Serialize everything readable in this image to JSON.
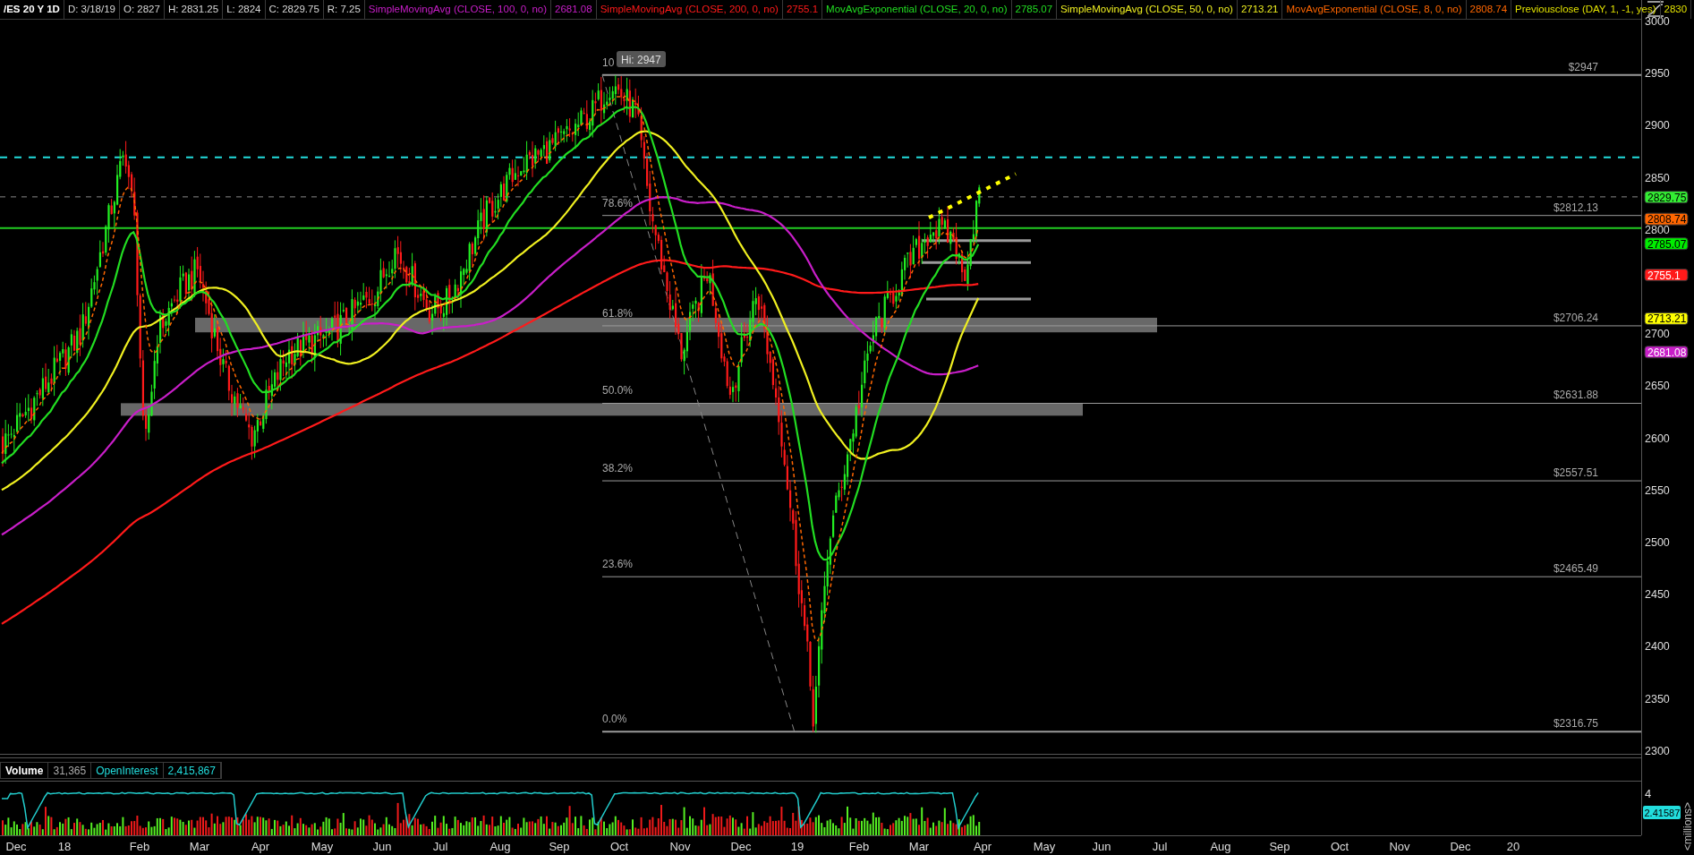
{
  "header": {
    "symbol": "/ES 20 Y 1D",
    "fields": [
      "D: 3/18/19",
      "O: 2827",
      "H: 2831.25",
      "L: 2824",
      "C: 2829.75",
      "R: 7.25"
    ],
    "studies": [
      {
        "name": "SimpleMovingAvg (CLOSE, 100, 0, no)",
        "value": "2681.08",
        "color": "#c81ec8"
      },
      {
        "name": "SimpleMovingAvg (CLOSE, 200, 0, no)",
        "value": "2755.1",
        "color": "#ff1a1a"
      },
      {
        "name": "MovAvgExponential (CLOSE, 20, 0, no)",
        "value": "2785.07",
        "color": "#22dd22"
      },
      {
        "name": "SimpleMovingAvg (CLOSE, 50, 0, no)",
        "value": "2713.21",
        "color": "#f0f020"
      },
      {
        "name": "MovAvgExponential (CLOSE, 8, 0, no)",
        "value": "2808.74",
        "color": "#ff6600"
      },
      {
        "name": "Previousclose (DAY, 1, -1, yes)",
        "value": "2830",
        "color": "#e0e000"
      }
    ]
  },
  "price_axis": [
    "3000",
    "2950",
    "2900",
    "2850",
    "2800",
    "2700",
    "2650",
    "2600",
    "2550",
    "2500",
    "2450",
    "2400",
    "2350",
    "2300"
  ],
  "price_tags": [
    {
      "value": "2829.75",
      "color": "#33ee33"
    },
    {
      "value": "2808.74",
      "color": "#ff6600"
    },
    {
      "value": "2785.07",
      "color": "#00ee00"
    },
    {
      "value": "2755.1",
      "color": "#ff1a1a"
    },
    {
      "value": "2713.21",
      "color": "#ffff00"
    },
    {
      "value": "2681.08",
      "color": "#c81ec8"
    }
  ],
  "hi_marker": "Hi: 2947",
  "fib_levels": [
    {
      "ratio": "10",
      "price": "$2947"
    },
    {
      "ratio": "78.6%",
      "price": "$2812.13"
    },
    {
      "ratio": "61.8%",
      "price": "$2706.24"
    },
    {
      "ratio": "50.0%",
      "price": "$2631.88"
    },
    {
      "ratio": "38.2%",
      "price": "$2557.51"
    },
    {
      "ratio": "23.6%",
      "price": "$2465.49"
    },
    {
      "ratio": "0.0%",
      "price": "$2316.75"
    }
  ],
  "volume_pane": {
    "legend": [
      {
        "label": "Volume",
        "value": "31,365",
        "kind": "volume"
      },
      {
        "label": "OpenInterest",
        "value": "2,415,867",
        "kind": "open_interest"
      }
    ],
    "axis": [
      "4"
    ],
    "tag": "2.41587",
    "unit": "<millions>"
  },
  "time_axis": [
    "Dec",
    "18",
    "Feb",
    "Mar",
    "Apr",
    "May",
    "Jun",
    "Jul",
    "Aug",
    "Sep",
    "Oct",
    "Nov",
    "Dec",
    "19",
    "Feb",
    "Mar",
    "Apr",
    "May",
    "Jun",
    "Jul",
    "Aug",
    "Sep",
    "Oct",
    "Nov",
    "Dec",
    "20"
  ]
}
